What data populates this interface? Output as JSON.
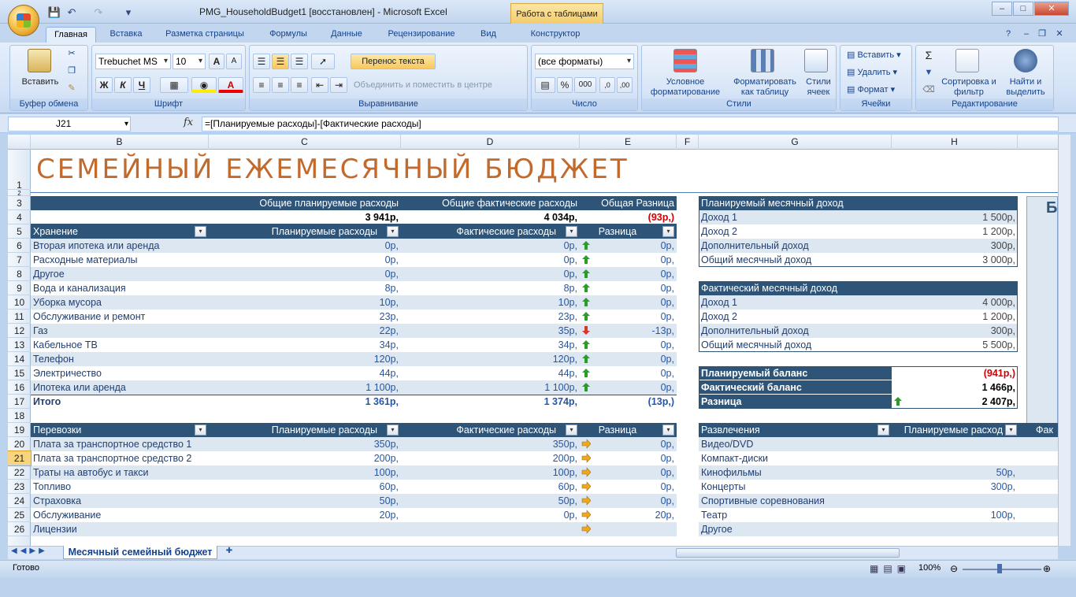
{
  "window": {
    "title": "PMG_HouseholdBudget1 [восстановлен] - Microsoft Excel",
    "context_tab": "Работа с таблицами"
  },
  "ribbon": {
    "tabs": [
      "Главная",
      "Вставка",
      "Разметка страницы",
      "Формулы",
      "Данные",
      "Рецензирование",
      "Вид",
      "Конструктор"
    ],
    "active_tab": "Главная",
    "clipboard": {
      "paste": "Вставить",
      "label": "Буфер обмена"
    },
    "font": {
      "name": "Trebuchet MS",
      "size": "10",
      "bold": "Ж",
      "italic": "К",
      "underline": "Ч",
      "label": "Шрифт"
    },
    "alignment": {
      "wrap": "Перенос текста",
      "merge": "Объединить и поместить в центре",
      "label": "Выравнивание"
    },
    "number": {
      "format": "(все форматы)",
      "label": "Число"
    },
    "styles": {
      "conditional": "Условное форматирование",
      "as_table": "Форматировать как таблицу",
      "cell_styles": "Стили ячеек",
      "label": "Стили"
    },
    "cells": {
      "insert": "Вставить",
      "delete": "Удалить",
      "format": "Формат",
      "label": "Ячейки"
    },
    "editing": {
      "sort": "Сортировка и фильтр",
      "find": "Найти и выделить",
      "label": "Редактирование"
    }
  },
  "formula_bar": {
    "name_box": "J21",
    "fx": "fx",
    "formula": "=[Планируемые расходы]-[Фактические расходы]"
  },
  "columns": [
    "B",
    "C",
    "D",
    "E",
    "F",
    "G",
    "H"
  ],
  "rows": [
    "1",
    "2",
    "3",
    "4",
    "5",
    "6",
    "7",
    "8",
    "9",
    "10",
    "11",
    "12",
    "13",
    "14",
    "15",
    "16",
    "17",
    "18",
    "19",
    "20",
    "21",
    "22",
    "23",
    "24",
    "25",
    "26"
  ],
  "sheet": {
    "title": "СЕМЕЙНЫЙ ЕЖЕМЕСЯЧНЫЙ БЮДЖЕТ",
    "summary_headers": [
      "Общие планируемые расходы",
      "Общие фактические расходы",
      "Общая Разница"
    ],
    "summary_values": [
      "3 941р,",
      "4 034р,",
      "(93р,)"
    ],
    "housing": {
      "headers": [
        "Хранение",
        "Планируемые расходы",
        "Фактические расходы",
        "Разница"
      ],
      "rows": [
        [
          "Вторая ипотека или аренда",
          "0р,",
          "0р,",
          "0р,"
        ],
        [
          "Расходные материалы",
          "0р,",
          "0р,",
          "0р,"
        ],
        [
          "Другое",
          "0р,",
          "0р,",
          "0р,"
        ],
        [
          "Вода и канализация",
          "8р,",
          "8р,",
          "0р,"
        ],
        [
          "Уборка мусора",
          "10р,",
          "10р,",
          "0р,"
        ],
        [
          "Обслуживание и ремонт",
          "23р,",
          "23р,",
          "0р,"
        ],
        [
          "Газ",
          "22р,",
          "35р,",
          "-13р,"
        ],
        [
          "Кабельное ТВ",
          "34р,",
          "34р,",
          "0р,"
        ],
        [
          "Телефон",
          "120р,",
          "120р,",
          "0р,"
        ],
        [
          "Электричество",
          "44р,",
          "44р,",
          "0р,"
        ],
        [
          "Ипотека или аренда",
          "1 100р,",
          "1 100р,",
          "0р,"
        ]
      ],
      "arrows": [
        "up",
        "up",
        "up",
        "up",
        "up",
        "up",
        "down",
        "up",
        "up",
        "up",
        "up"
      ],
      "total": [
        "Итого",
        "1 361р,",
        "1 374р,",
        "(13р,)"
      ]
    },
    "transport": {
      "headers": [
        "Перевозки",
        "Планируемые расходы",
        "Фактические расходы",
        "Разница"
      ],
      "rows": [
        [
          "Плата за транспортное средство 1",
          "350р,",
          "350р,",
          "0р,"
        ],
        [
          "Плата за транспортное средство 2",
          "200р,",
          "200р,",
          "0р,"
        ],
        [
          "Траты на автобус и такси",
          "100р,",
          "100р,",
          "0р,"
        ],
        [
          "Топливо",
          "60р,",
          "60р,",
          "0р,"
        ],
        [
          "Страховка",
          "50р,",
          "50р,",
          "0р,"
        ],
        [
          "Обслуживание",
          "20р,",
          "0р,",
          "20р,"
        ],
        [
          "Лицензии",
          "",
          "",
          ""
        ]
      ]
    },
    "planned_income": {
      "header": "Планируемый месячный доход",
      "rows": [
        [
          "Доход 1",
          "1 500р,"
        ],
        [
          "Доход 2",
          "1 200р,"
        ],
        [
          "Дополнительный доход",
          "300р,"
        ],
        [
          "Общий месячный доход",
          "3 000р,"
        ]
      ]
    },
    "actual_income": {
      "header": "Фактический месячный доход",
      "rows": [
        [
          "Доход 1",
          "4 000р,"
        ],
        [
          "Доход 2",
          "1 200р,"
        ],
        [
          "Дополнительный доход",
          "300р,"
        ],
        [
          "Общий месячный доход",
          "5 500р,"
        ]
      ]
    },
    "balance": {
      "rows": [
        [
          "Планируемый баланс",
          "(941р,)"
        ],
        [
          "Фактический баланс",
          "1 466р,"
        ],
        [
          "Разница",
          "2 407р,"
        ]
      ]
    },
    "entertainment": {
      "headers": [
        "Развлечения",
        "Планируемые расход",
        "Фак"
      ],
      "rows": [
        [
          "Видео/DVD",
          ""
        ],
        [
          "Компакт-диски",
          ""
        ],
        [
          "Кинофильмы",
          "50р,"
        ],
        [
          "Концерты",
          "300р,"
        ],
        [
          "Спортивные соревнования",
          ""
        ],
        [
          "Театр",
          "100р,"
        ],
        [
          "Другое",
          ""
        ]
      ]
    },
    "side_letter": "Б"
  },
  "sheet_tab": "Месячный семейный бюджет",
  "status": {
    "ready": "Готово",
    "zoom": "100%"
  },
  "colors": {
    "header_bar": "#2e5478",
    "band": "#dde7f2",
    "title": "#c26a2c",
    "accent_blue": "#2456a6",
    "negative": "#d20000"
  }
}
